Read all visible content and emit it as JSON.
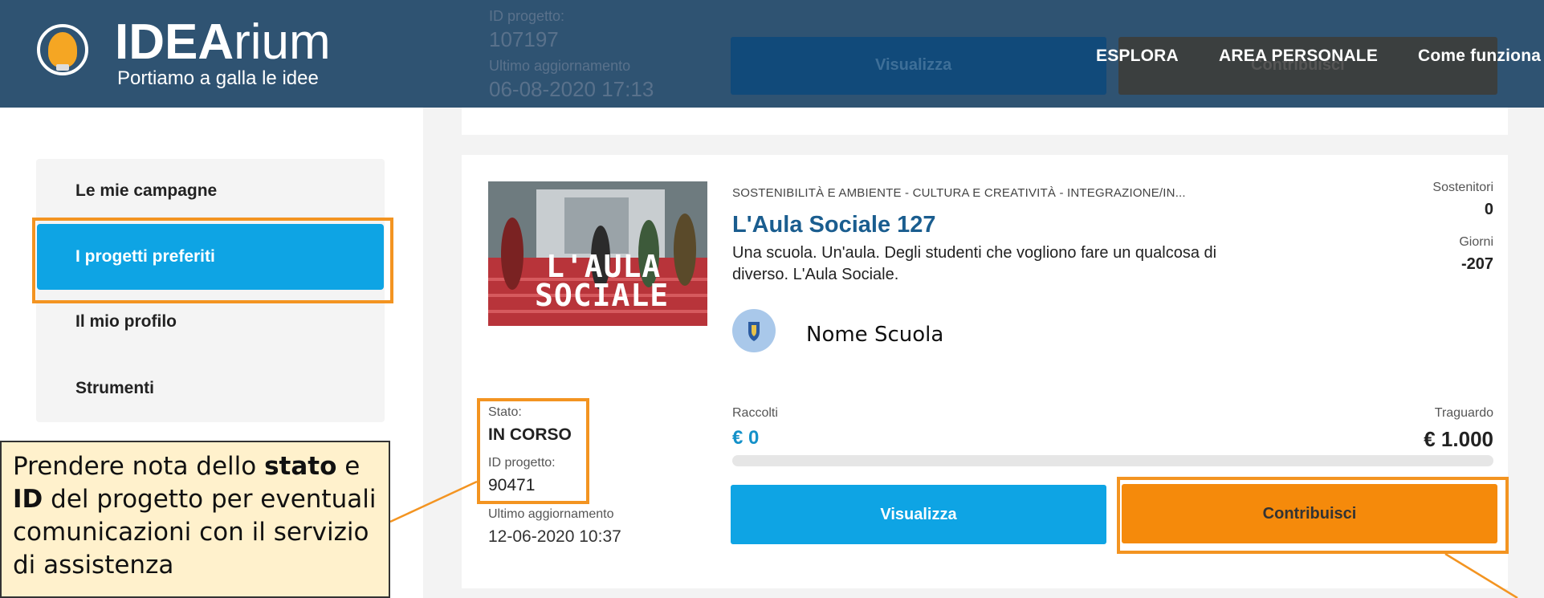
{
  "header": {
    "logo_bold": "IDEA",
    "logo_rest": "rium",
    "tagline": "Portiamo a galla le idee",
    "nav": [
      "ESPLORA",
      "AREA PERSONALE",
      "Come funziona"
    ]
  },
  "previous_card": {
    "id_label": "ID progetto:",
    "id_value": "107197",
    "updated_label": "Ultimo aggiornamento",
    "updated_value": "06-08-2020 17:13",
    "view_button": "Visualizza",
    "contribute_button": "Contribuisci"
  },
  "sidebar": {
    "items": [
      {
        "label": "Le mie campagne"
      },
      {
        "label": "I progetti preferiti"
      },
      {
        "label": "Il mio profilo"
      },
      {
        "label": "Strumenti"
      }
    ]
  },
  "project": {
    "thumbnail_text_1": "L'AULA",
    "thumbnail_text_2": "SOCIALE",
    "categories": "SOSTENIBILITÀ E AMBIENTE - CULTURA E CREATIVITÀ - INTEGRAZIONE/IN...",
    "title": "L'Aula Sociale 127",
    "description": "Una scuola. Un'aula. Degli studenti che vogliono fare un qualcosa di diverso. L'Aula Sociale.",
    "school_name": "Nome Scuola",
    "supporters_label": "Sostenitori",
    "supporters_value": "0",
    "days_label": "Giorni",
    "days_value": "-207",
    "status_label": "Stato:",
    "status_value": "IN CORSO",
    "id_label": "ID progetto:",
    "id_value": "90471",
    "updated_label": "Ultimo aggiornamento",
    "updated_value": "12-06-2020 10:37",
    "raised_label": "Raccolti",
    "raised_value": "€ 0",
    "goal_label": "Traguardo",
    "goal_value": "€ 1.000",
    "progress_fraction": 0,
    "view_button": "Visualizza",
    "contribute_button": "Contribuisci"
  },
  "callout": {
    "part1": "Prendere nota dello ",
    "bold1": "stato",
    "part2": " e ",
    "bold2": "ID",
    "part3": " del progetto per eventuali comunicazioni con il servizio di assistenza"
  },
  "colors": {
    "header": "#2f5372",
    "accent_blue": "#0ea4e4",
    "accent_orange": "#f58a0b",
    "highlight": "#f39421",
    "title_blue": "#1a5d8f"
  }
}
